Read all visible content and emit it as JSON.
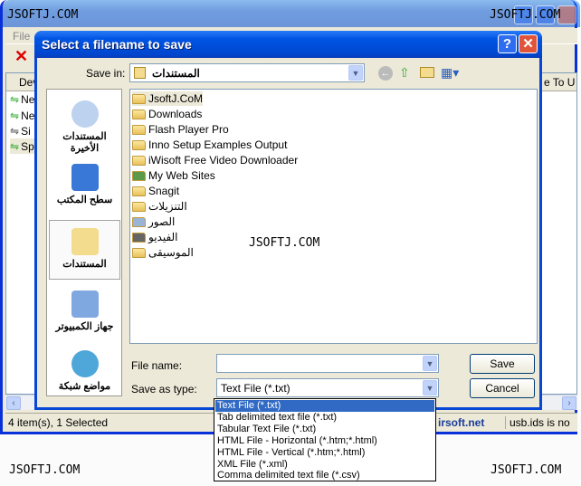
{
  "watermark": "JSOFTJ.COM",
  "main_window": {
    "menu": [
      "File"
    ],
    "list_header": {
      "col1": "Dev",
      "col_right": "e To U"
    },
    "rows": [
      "Ne",
      "Ne",
      "Si",
      "Sp"
    ],
    "status": {
      "items": "4 item(s), 1 Selected",
      "link": "irsoft.net",
      "usb": "usb.ids is no"
    }
  },
  "dialog": {
    "title": "Select a filename to save",
    "help": "?",
    "close": "✕",
    "save_in_label": "Save in:",
    "save_in_value": "المستندات",
    "places": [
      "المستندات الأخيرة",
      "سطح المكتب",
      "المستندات",
      "جهاز الكمبيوتر",
      "مواضع شبكة"
    ],
    "selected_place": 2,
    "files": [
      {
        "name": "JsoftJ.CoM",
        "icon": "folder"
      },
      {
        "name": "Downloads",
        "icon": "folder"
      },
      {
        "name": "Flash Player Pro",
        "icon": "folder"
      },
      {
        "name": "Inno Setup Examples Output",
        "icon": "folder"
      },
      {
        "name": "iWisoft Free Video Downloader",
        "icon": "folder"
      },
      {
        "name": "My Web Sites",
        "icon": "web-folder"
      },
      {
        "name": "Snagit",
        "icon": "folder"
      },
      {
        "name": "التنزيلات",
        "icon": "folder"
      },
      {
        "name": "الصور",
        "icon": "pictures-folder"
      },
      {
        "name": "الفيديو",
        "icon": "video-folder"
      },
      {
        "name": "الموسيقى",
        "icon": "music-folder"
      }
    ],
    "file_name_label": "File name:",
    "file_name_value": "",
    "save_type_label": "Save as type:",
    "save_type_value": "Text File (*.txt)",
    "save_button": "Save",
    "cancel_button": "Cancel",
    "type_options": [
      "Text File (*.txt)",
      "Tab delimited text file (*.txt)",
      "Tabular Text File (*.txt)",
      "HTML File - Horizontal (*.htm;*.html)",
      "HTML File - Vertical (*.htm;*.html)",
      "XML File (*.xml)",
      "Comma delimited text file (*.csv)"
    ],
    "selected_option": 0
  },
  "colors": {
    "title_blue": "#0054e3",
    "selection": "#316ac5",
    "close_red": "#e0553a"
  }
}
